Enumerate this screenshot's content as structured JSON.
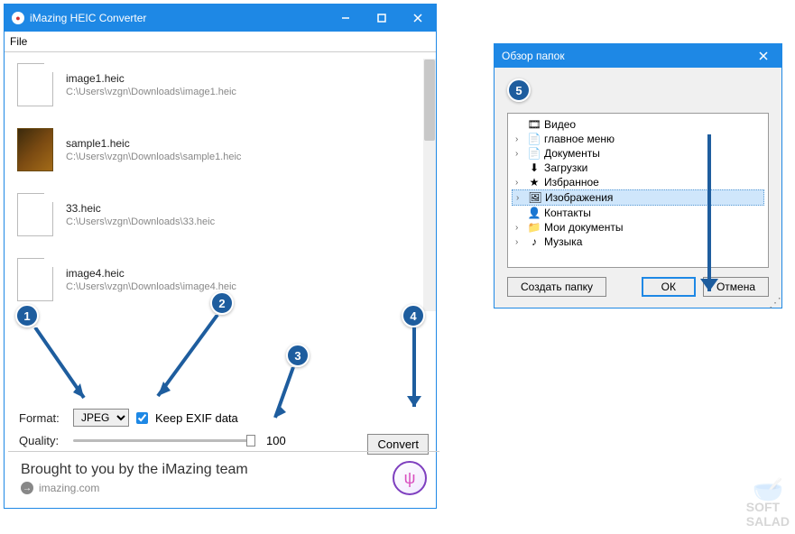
{
  "app": {
    "title": "iMazing HEIC Converter",
    "menu_file": "File"
  },
  "files": [
    {
      "name": "image1.heic",
      "path": "C:\\Users\\vzgn\\Downloads\\image1.heic",
      "thumb": "doc"
    },
    {
      "name": "sample1.heic",
      "path": "C:\\Users\\vzgn\\Downloads\\sample1.heic",
      "thumb": "sample"
    },
    {
      "name": "33.heic",
      "path": "C:\\Users\\vzgn\\Downloads\\33.heic",
      "thumb": "doc"
    },
    {
      "name": "image4.heic",
      "path": "C:\\Users\\vzgn\\Downloads\\image4.heic",
      "thumb": "doc"
    }
  ],
  "controls": {
    "format_label": "Format:",
    "format_value": "JPEG",
    "keep_exif_label": "Keep EXIF data",
    "keep_exif_checked": true,
    "quality_label": "Quality:",
    "quality_value": "100",
    "convert_button": "Convert"
  },
  "footer": {
    "brought": "Brought to you by the iMazing team",
    "link_text": "imazing.com"
  },
  "callouts": {
    "1": "1",
    "2": "2",
    "3": "3",
    "4": "4",
    "5": "5"
  },
  "browse": {
    "title": "Обзор папок",
    "items": [
      {
        "label": "Видео",
        "icon": "🎞",
        "chev": ""
      },
      {
        "label": "главное меню",
        "icon": "📄",
        "chev": "›"
      },
      {
        "label": "Документы",
        "icon": "📄",
        "chev": "›"
      },
      {
        "label": "Загрузки",
        "icon": "⬇",
        "chev": ""
      },
      {
        "label": "Избранное",
        "icon": "★",
        "chev": "›"
      },
      {
        "label": "Изображения",
        "icon": "🖼",
        "chev": "›",
        "selected": true
      },
      {
        "label": "Контакты",
        "icon": "👤",
        "chev": ""
      },
      {
        "label": "Мои документы",
        "icon": "📁",
        "chev": "›"
      },
      {
        "label": "Музыка",
        "icon": "♪",
        "chev": "›"
      }
    ],
    "create_folder": "Создать папку",
    "ok": "ОК",
    "cancel": "Отмена"
  },
  "watermark": {
    "line1": "SOFT",
    "line2": "SALAD"
  }
}
